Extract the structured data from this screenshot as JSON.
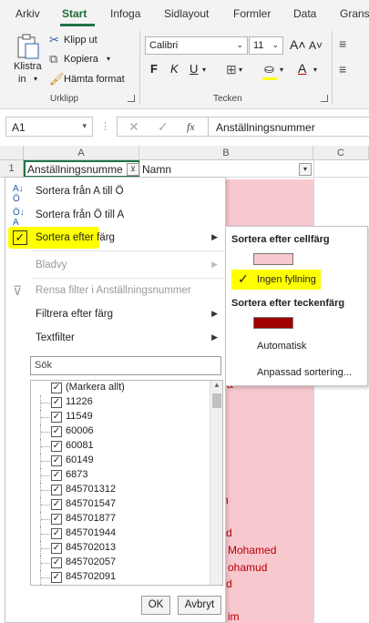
{
  "ribbon_tabs": [
    "Arkiv",
    "Start",
    "Infoga",
    "Sidlayout",
    "Formler",
    "Data",
    "Grans"
  ],
  "clipboard": {
    "paste_label": "Klistra",
    "paste_sub": "in",
    "cut": "Klipp ut",
    "copy": "Kopiera",
    "format_painter": "Hämta format",
    "group_label": "Urklipp"
  },
  "font": {
    "name": "Calibri",
    "size": "11",
    "group_label": "Tecken",
    "bold": "F",
    "italic": "K",
    "underline": "U"
  },
  "formula_bar": {
    "name_box": "A1",
    "fx": "fx",
    "value": "Anställningsnummer"
  },
  "grid": {
    "col_a": "A",
    "col_b": "B",
    "col_c": "C",
    "row1": "1",
    "a1": "Anställningsnumme",
    "b1": "Namn"
  },
  "pink_fragments": [
    "a",
    "n",
    "d",
    "Mohamed",
    "ohamud",
    "d",
    "im"
  ],
  "menu": {
    "sort_asc": "Sortera från A till Ö",
    "sort_desc": "Sortera från Ö till A",
    "sort_by_color": "Sortera efter färg",
    "sheet_view": "Bladvy",
    "clear_filter": "Rensa filter i Anställningsnummer",
    "filter_by_color": "Filtrera efter färg",
    "text_filter": "Textfilter",
    "search_placeholder": "Sök",
    "items": [
      "(Markera allt)",
      "11226",
      "11549",
      "60006",
      "60081",
      "60149",
      "6873",
      "845701312",
      "845701547",
      "845701877",
      "845701944",
      "845702013",
      "845702057",
      "845702091"
    ],
    "ok": "OK",
    "cancel": "Avbryt"
  },
  "submenu": {
    "by_cell_color": "Sortera efter cellfärg",
    "cell_color": "#f8c8cf",
    "no_fill": "Ingen fyllning",
    "by_font_color": "Sortera efter teckenfärg",
    "font_color": "#a00000",
    "automatic": "Automatisk",
    "custom_sort": "Anpassad sortering..."
  },
  "colors": {
    "accent": "#217346",
    "highlight": "#ffff00",
    "row_fill": "#f8c8cf",
    "text_red": "#b30000"
  }
}
